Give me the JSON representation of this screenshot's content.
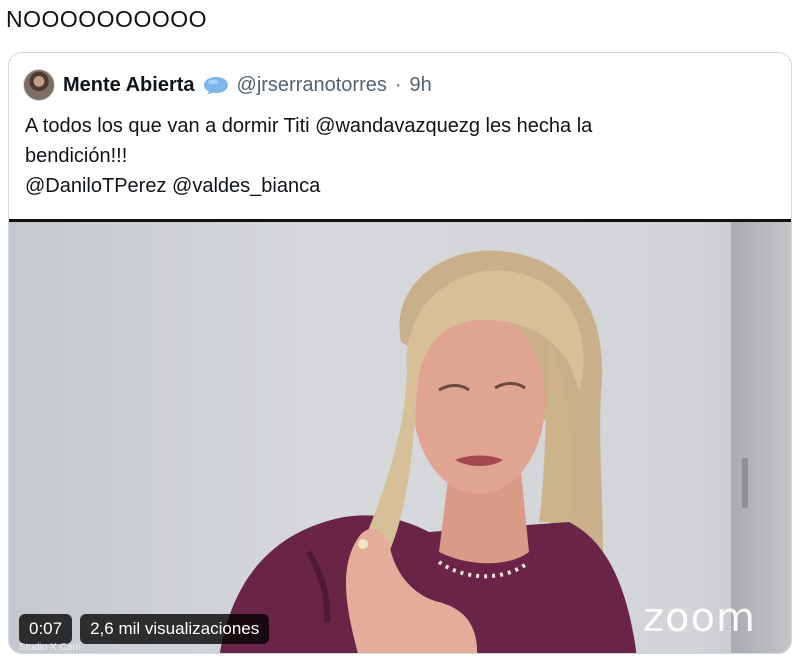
{
  "tweet": {
    "text": "NOOOOOOOOOO"
  },
  "quoted": {
    "name": "Mente Abierta",
    "handle": "@jrserranotorres",
    "separator": "·",
    "time": "9h",
    "body_lines": [
      "A todos los que van a dormir Titi @wandavazquezg les hecha la",
      "bendición!!!",
      "@DaniloTPerez @valdes_bianca"
    ],
    "verified_color": "#1d9bf0"
  },
  "video": {
    "duration": "0:07",
    "views": "2,6 mil visualizaciones",
    "zoom_label": "zoom",
    "watermark": "Studio X Cam"
  }
}
